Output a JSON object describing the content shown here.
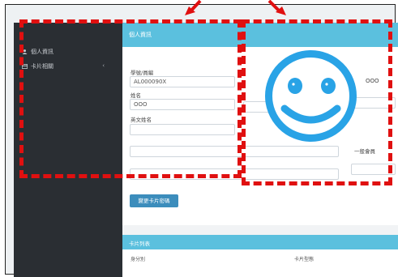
{
  "sidebar": {
    "items": [
      {
        "label": "個人資訊",
        "icon": "user-icon"
      },
      {
        "label": "卡片相關",
        "icon": "card-icon"
      }
    ]
  },
  "panel": {
    "title": "個人資訊",
    "fields": {
      "id_label": "學號/員編",
      "id_value": "AL000090X",
      "name_label": "姓名",
      "name_value": "OOO",
      "english_label": "英文姓名",
      "right_value": "OOO",
      "member_label": "一般會員"
    },
    "button_label": "變更卡片密碼"
  },
  "panel2": {
    "title": "卡片列表",
    "columns": [
      "身分別",
      "卡片型態"
    ]
  },
  "colors": {
    "annotation": "#e01010",
    "smiley": "#29a3e6",
    "header": "#5bc0de"
  }
}
